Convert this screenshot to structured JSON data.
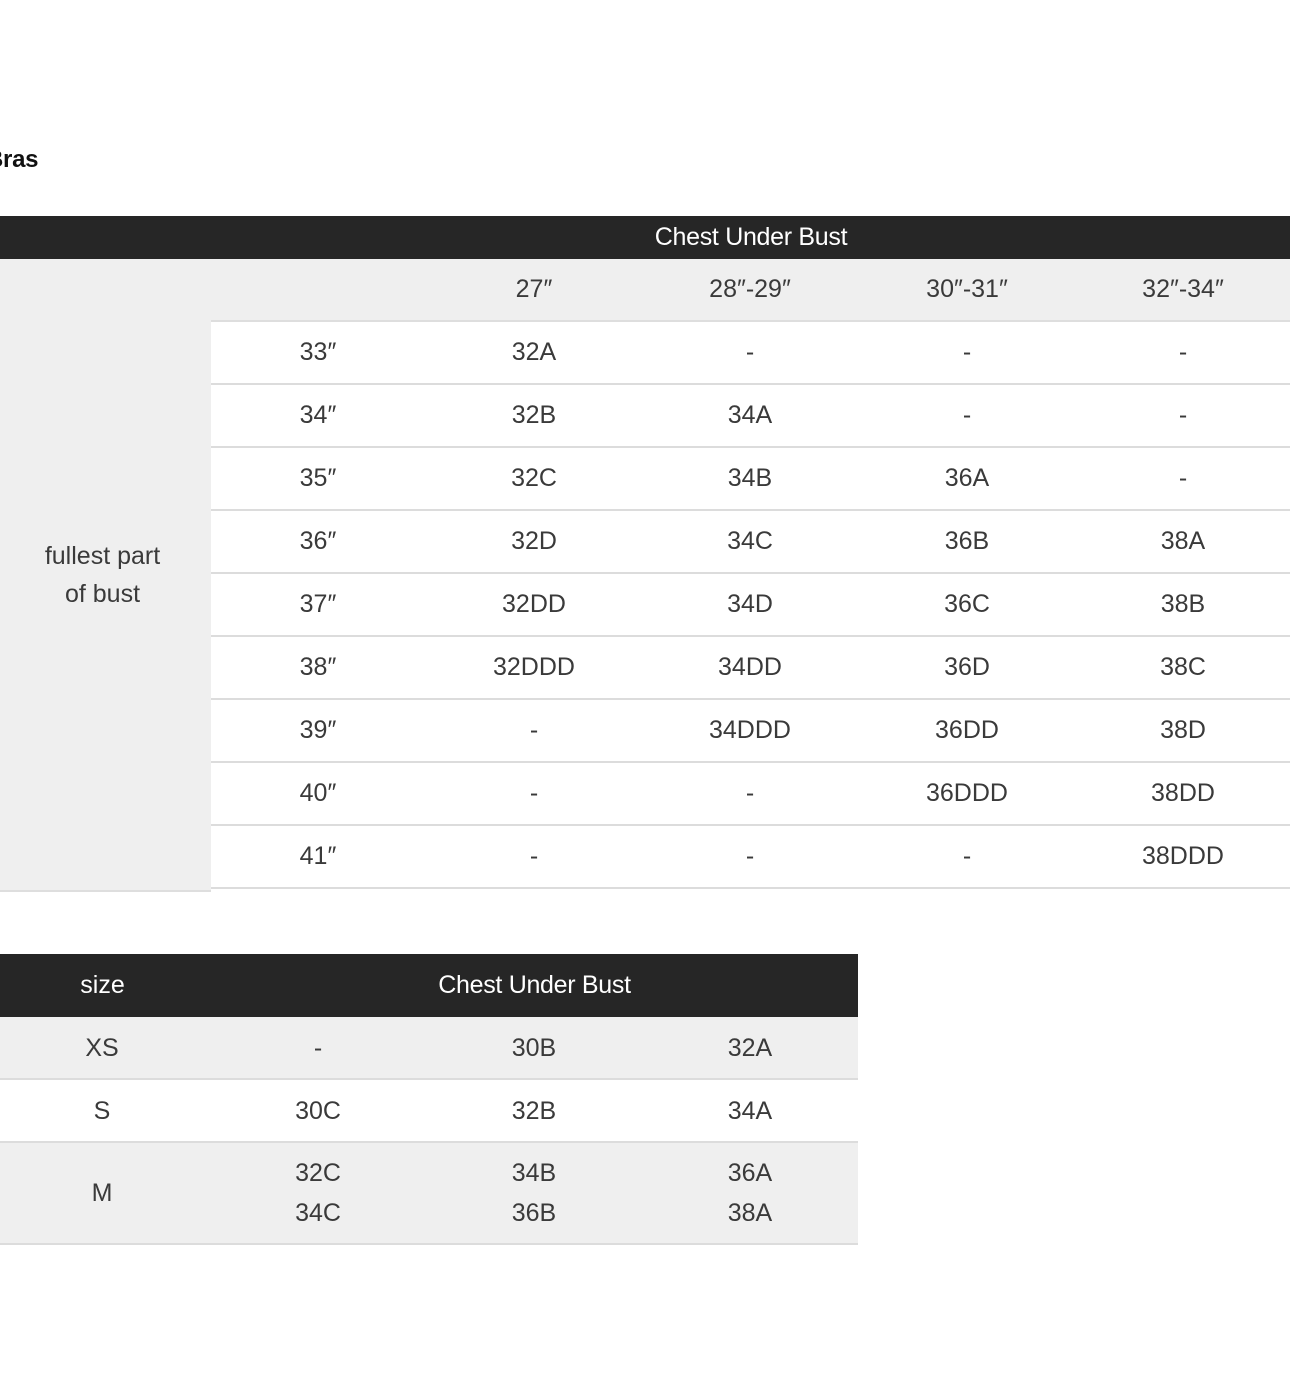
{
  "section_title": "Bras",
  "table1": {
    "header": "Chest Under Bust",
    "row_group_label_line1": "fullest part",
    "row_group_label_line2": "of bust",
    "columns": [
      "27″",
      "28″-29″",
      "30″-31″",
      "32″-34″"
    ],
    "rows": [
      {
        "label": "33″",
        "values": [
          "32A",
          "-",
          "-",
          "-"
        ]
      },
      {
        "label": "34″",
        "values": [
          "32B",
          "34A",
          "-",
          "-"
        ]
      },
      {
        "label": "35″",
        "values": [
          "32C",
          "34B",
          "36A",
          "-"
        ]
      },
      {
        "label": "36″",
        "values": [
          "32D",
          "34C",
          "36B",
          "38A"
        ]
      },
      {
        "label": "37″",
        "values": [
          "32DD",
          "34D",
          "36C",
          "38B"
        ]
      },
      {
        "label": "38″",
        "values": [
          "32DDD",
          "34DD",
          "36D",
          "38C"
        ]
      },
      {
        "label": "39″",
        "values": [
          "-",
          "34DDD",
          "36DD",
          "38D"
        ]
      },
      {
        "label": "40″",
        "values": [
          "-",
          "-",
          "36DDD",
          "38DD"
        ]
      },
      {
        "label": "41″",
        "values": [
          "-",
          "-",
          "-",
          "38DDD"
        ]
      }
    ]
  },
  "table2": {
    "size_header": "size",
    "chest_header": "Chest Under Bust",
    "rows": [
      {
        "size": "XS",
        "values": [
          [
            "-"
          ],
          [
            "30B"
          ],
          [
            "32A"
          ]
        ]
      },
      {
        "size": "S",
        "values": [
          [
            "30C"
          ],
          [
            "32B"
          ],
          [
            "34A"
          ]
        ]
      },
      {
        "size": "M",
        "values": [
          [
            "32C",
            "34C"
          ],
          [
            "34B",
            "36B"
          ],
          [
            "36A",
            "38A"
          ]
        ]
      }
    ]
  }
}
